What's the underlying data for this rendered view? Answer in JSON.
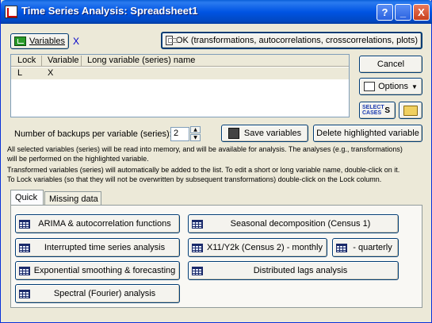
{
  "window": {
    "title": "Time Series Analysis: Spreadsheet1"
  },
  "titlebar_buttons": {
    "help": "?",
    "minimize": "_",
    "close": "X"
  },
  "variables": {
    "button_label": "Variables",
    "selected": "X"
  },
  "ok_button": "OK (transformations, autocorrelations, crosscorrelations, plots)",
  "cancel_button": "Cancel",
  "options_button": "Options",
  "select_cases": {
    "line1": "SELECT",
    "line2": "CASES",
    "symbol": "S"
  },
  "variable_list": {
    "columns": [
      "Lock",
      "Variable",
      "Long variable (series) name"
    ],
    "rows": [
      {
        "lock": "L",
        "variable": "X",
        "long_name": ""
      }
    ]
  },
  "backups": {
    "label": "Number of backups per variable (series):",
    "value": "2"
  },
  "save_variables_button": "Save variables",
  "delete_variable_button": "Delete highlighted variable",
  "info": {
    "line1": "All selected variables (series) will be read into memory, and will be available for analysis. The analyses (e.g., transformations)",
    "line2": "will be performed on the highlighted variable.",
    "line3": "Transformed variables (series) will automatically be added to the list. To edit a short or long variable name, double-click on it.",
    "line4": "To Lock variables (so that they will not be overwritten by subsequent transformations) double-click on the Lock column."
  },
  "tabs": [
    "Quick",
    "Missing data"
  ],
  "quick_buttons": {
    "arima": "ARIMA & autocorrelation functions",
    "seasonal": "Seasonal decomposition (Census 1)",
    "interrupted": "Interrupted time series analysis",
    "x11_monthly": "X11/Y2k (Census 2) - monthly",
    "quarterly": "- quarterly",
    "exponential": "Exponential smoothing & forecasting",
    "distributed": "Distributed lags analysis",
    "spectral": "Spectral (Fourier) analysis"
  },
  "colors": {
    "title_bar": "#0054e3",
    "dialog_bg": "#ece9d8"
  }
}
